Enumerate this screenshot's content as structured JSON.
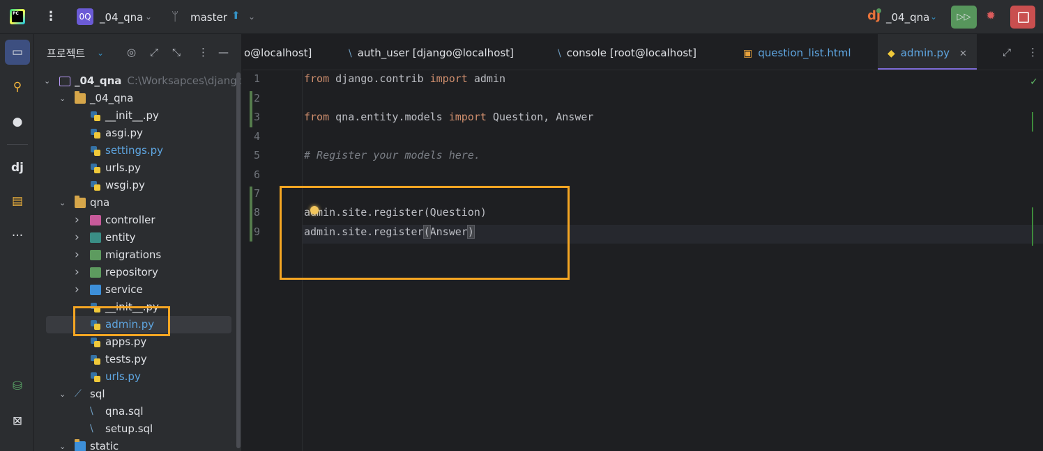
{
  "topbar": {
    "logo_text": "PC",
    "project_badge": "0Q",
    "project_name": "_04_qna",
    "branch": "master",
    "run_config_name": "_04_qna",
    "icons": [
      "main-menu-icon",
      "branch-icon",
      "push-arrow-icon",
      "django-icon",
      "run-icon",
      "debug-icon",
      "stop-icon"
    ],
    "run_color": "#57965c",
    "stop_color": "#c94f4f"
  },
  "sidebar_strip": {
    "items": [
      "project-icon",
      "commit-icon",
      "github-icon",
      "django-structure-icon",
      "services-icon",
      "more-icon",
      "database-add-icon",
      "excel-icon"
    ]
  },
  "project_panel": {
    "title": "프로젝트",
    "tree": [
      {
        "label": "_04_qna",
        "hint": "C:\\Worksapces\\django",
        "kind": "root",
        "expanded": true
      },
      {
        "label": "_04_qna",
        "kind": "folder",
        "expanded": true
      },
      {
        "label": "__init__.py",
        "kind": "py"
      },
      {
        "label": "asgi.py",
        "kind": "py"
      },
      {
        "label": "settings.py",
        "kind": "py",
        "modified": true
      },
      {
        "label": "urls.py",
        "kind": "py"
      },
      {
        "label": "wsgi.py",
        "kind": "py"
      },
      {
        "label": "qna",
        "kind": "folder",
        "expanded": true
      },
      {
        "label": "controller",
        "kind": "package-controller"
      },
      {
        "label": "entity",
        "kind": "package-entity"
      },
      {
        "label": "migrations",
        "kind": "package-migrations"
      },
      {
        "label": "repository",
        "kind": "package-repository"
      },
      {
        "label": "service",
        "kind": "package-service"
      },
      {
        "label": "__init__.py",
        "kind": "py"
      },
      {
        "label": "admin.py",
        "kind": "py",
        "modified": true,
        "selected": true
      },
      {
        "label": "apps.py",
        "kind": "py"
      },
      {
        "label": "tests.py",
        "kind": "py"
      },
      {
        "label": "urls.py",
        "kind": "py",
        "modified": true
      },
      {
        "label": "sql",
        "kind": "sql-folder",
        "expanded": true
      },
      {
        "label": "qna.sql",
        "kind": "sql"
      },
      {
        "label": "setup.sql",
        "kind": "sql"
      },
      {
        "label": "static",
        "kind": "web-folder",
        "expanded": true
      }
    ]
  },
  "tabs": [
    {
      "label": "o@localhost]",
      "kind": "console"
    },
    {
      "label": "auth_user [django@localhost]",
      "kind": "table"
    },
    {
      "label": "console [root@localhost]",
      "kind": "console"
    },
    {
      "label": "question_list.html",
      "kind": "html",
      "modified": true
    },
    {
      "label": "admin.py",
      "kind": "py",
      "active": true,
      "modified": true
    }
  ],
  "editor": {
    "line_numbers": [
      "1",
      "2",
      "3",
      "4",
      "5",
      "6",
      "7",
      "8",
      "9"
    ],
    "lines": [
      [
        {
          "t": "from",
          "c": "kw"
        },
        {
          "t": " django.contrib "
        },
        {
          "t": "import",
          "c": "kw"
        },
        {
          "t": " admin"
        }
      ],
      [],
      [
        {
          "t": "from",
          "c": "kw"
        },
        {
          "t": " qna.entity.models "
        },
        {
          "t": "import",
          "c": "kw"
        },
        {
          "t": " Question, Answer"
        }
      ],
      [],
      [
        {
          "t": "# Register your models here.",
          "c": "cm"
        }
      ],
      [],
      [],
      [
        {
          "t": "admin.site.register"
        },
        {
          "t": "(",
          "c": "paren"
        },
        {
          "t": "Question"
        },
        {
          "t": ")",
          "c": "paren"
        }
      ],
      [
        {
          "t": "admin.site.register"
        },
        {
          "t": "(",
          "c": "paren hl"
        },
        {
          "t": "Answer"
        },
        {
          "t": ")",
          "c": "paren hl"
        }
      ]
    ],
    "status_icon": "check-icon"
  },
  "annotations": {
    "highlight_color": "#f5a623"
  }
}
